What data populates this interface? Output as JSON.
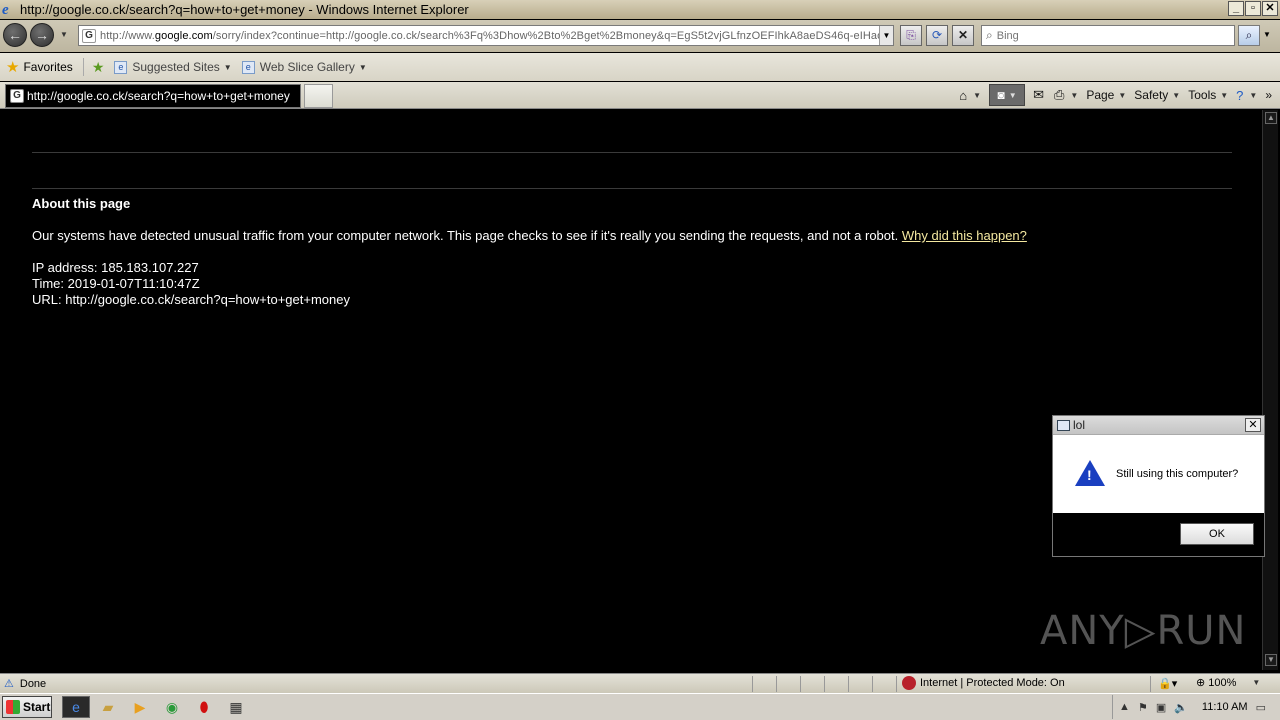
{
  "window": {
    "title": "http://google.co.ck/search?q=how+to+get+money - Windows Internet Explorer",
    "buttons": {
      "minimize": "_",
      "maximize": "▫",
      "close": "✕"
    }
  },
  "nav": {
    "address_host_prefix": "http://www.",
    "address_host": "google.com",
    "address_rest": "/sorry/index?continue=http://google.co.ck/search%3Fq%3Dhow%2Bto%2Bget%2Bmoney&q=EgS5t2vjGLfnzOEFIhkA8aeDS46q-eIHaou",
    "search_placeholder": "Bing"
  },
  "favorites": {
    "label": "Favorites",
    "items": [
      {
        "label": "Suggested Sites"
      },
      {
        "label": "Web Slice Gallery"
      }
    ]
  },
  "tabs": [
    {
      "label": "http://google.co.ck/search?q=how+to+get+money",
      "active": true
    }
  ],
  "commands": {
    "page": "Page",
    "safety": "Safety",
    "tools": "Tools"
  },
  "content": {
    "heading": "About this page",
    "message": "Our systems have detected unusual traffic from your computer network. This page checks to see if it's really you sending the requests, and not a robot.",
    "link": "Why did this happen?",
    "ip_line": "IP address: 185.183.107.227",
    "time_line": "Time: 2019-01-07T11:10:47Z",
    "url_line": "URL: http://google.co.ck/search?q=how+to+get+money"
  },
  "dialog": {
    "title": "lol",
    "message": "Still using this computer?",
    "ok_label": "OK",
    "icon": "warning-icon"
  },
  "watermark": "ANY▷RUN",
  "statusbar": {
    "status": "Done",
    "zone": "Internet | Protected Mode: On",
    "zoom": "100%"
  },
  "taskbar": {
    "start_label": "Start",
    "clock": "11:10 AM"
  },
  "colors": {
    "content_bg": "#000000",
    "link": "#f4e8a0",
    "dialog_icon": "#1a3fc0"
  }
}
